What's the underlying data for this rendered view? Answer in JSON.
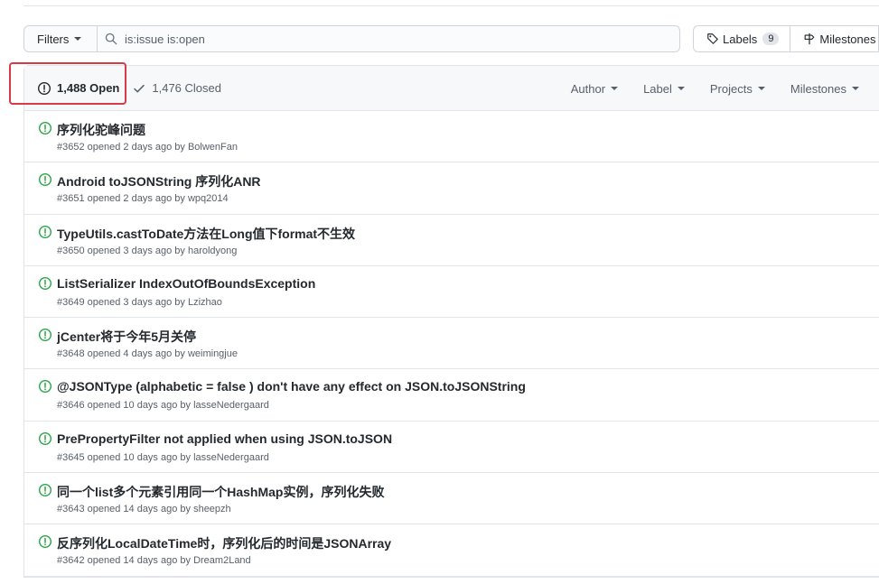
{
  "filters_label": "Filters",
  "search_value": "is:issue is:open",
  "labels_button": {
    "label": "Labels",
    "count": "9"
  },
  "milestones_button": {
    "label": "Milestones"
  },
  "open_count_label": "1,488 Open",
  "closed_count_label": "1,476 Closed",
  "header_filters": [
    "Author",
    "Label",
    "Projects",
    "Milestones"
  ],
  "colors": {
    "open_icon": "#28a745",
    "highlight": "#d73a49"
  },
  "issues": [
    {
      "title": "序列化驼峰问题",
      "meta": "#3652 opened 2 days ago by BolwenFan"
    },
    {
      "title": "Android toJSONString 序列化ANR",
      "meta": "#3651 opened 2 days ago by wpq2014"
    },
    {
      "title": "TypeUtils.castToDate方法在Long值下format不生效",
      "meta": "#3650 opened 3 days ago by haroldyong"
    },
    {
      "title": "ListSerializer IndexOutOfBoundsException",
      "meta": "#3649 opened 3 days ago by Lzizhao"
    },
    {
      "title": "jCenter将于今年5月关停",
      "meta": "#3648 opened 4 days ago by weimingjue"
    },
    {
      "title": "@JSONType (alphabetic = false ) don't have any effect on JSON.toJSONString",
      "meta": "#3646 opened 10 days ago by lasseNedergaard"
    },
    {
      "title": "PrePropertyFilter not applied when using JSON.toJSON",
      "meta": "#3645 opened 10 days ago by lasseNedergaard"
    },
    {
      "title": "同一个list多个元素引用同一个HashMap实例，序列化失败",
      "meta": "#3643 opened 14 days ago by sheepzh"
    },
    {
      "title": "反序列化LocalDateTime时，序列化后的时间是JSONArray",
      "meta": "#3642 opened 14 days ago by Dream2Land"
    }
  ]
}
